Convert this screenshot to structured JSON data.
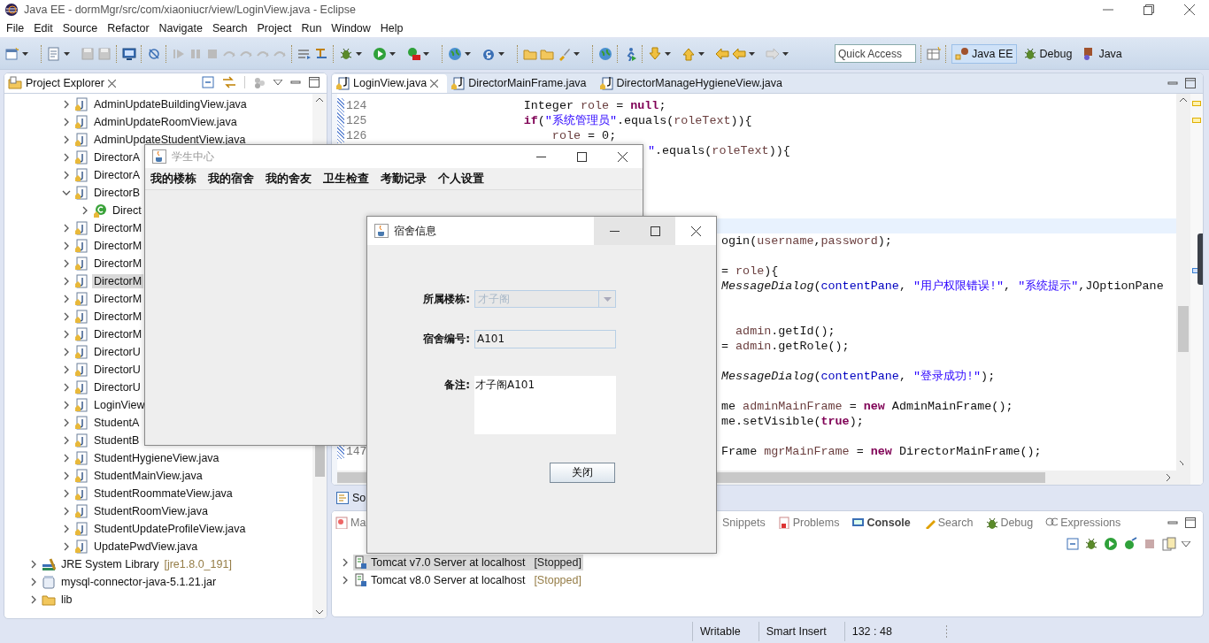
{
  "window": {
    "title": "Java EE - dormMgr/src/com/xiaoniucr/view/LoginView.java - Eclipse"
  },
  "menu": [
    "File",
    "Edit",
    "Source",
    "Refactor",
    "Navigate",
    "Search",
    "Project",
    "Run",
    "Window",
    "Help"
  ],
  "quick_access": {
    "placeholder": "Quick Access"
  },
  "perspectives": [
    {
      "label": "Java EE",
      "selected": true
    },
    {
      "label": "Debug",
      "selected": false
    },
    {
      "label": "Java",
      "selected": false
    }
  ],
  "project_explorer": {
    "title": "Project Explorer",
    "package_items": [
      {
        "label": "AdminUpdateBuildingView.java",
        "expanded": false,
        "selected": false
      },
      {
        "label": "AdminUpdateRoomView.java",
        "expanded": false,
        "selected": false
      },
      {
        "label": "AdminUpdateStudentView.java",
        "expanded": false,
        "selected": false
      },
      {
        "label": "DirectorA",
        "expanded": false,
        "selected": false
      },
      {
        "label": "DirectorA",
        "expanded": false,
        "selected": false
      },
      {
        "label": "DirectorB",
        "expanded": true,
        "selected": false,
        "children": [
          {
            "label": "Direct",
            "expanded": false,
            "selected": false
          }
        ]
      },
      {
        "label": "DirectorM",
        "expanded": false,
        "selected": false
      },
      {
        "label": "DirectorM",
        "expanded": false,
        "selected": false
      },
      {
        "label": "DirectorM",
        "expanded": false,
        "selected": false
      },
      {
        "label": "DirectorM",
        "expanded": false,
        "selected": true
      },
      {
        "label": "DirectorM",
        "expanded": false,
        "selected": false
      },
      {
        "label": "DirectorM",
        "expanded": false,
        "selected": false
      },
      {
        "label": "DirectorM",
        "expanded": false,
        "selected": false
      },
      {
        "label": "DirectorU",
        "expanded": false,
        "selected": false
      },
      {
        "label": "DirectorU",
        "expanded": false,
        "selected": false
      },
      {
        "label": "DirectorU",
        "expanded": false,
        "selected": false
      },
      {
        "label": "LoginView",
        "expanded": false,
        "selected": false
      },
      {
        "label": "StudentA",
        "expanded": false,
        "selected": false
      },
      {
        "label": "StudentB",
        "expanded": false,
        "selected": false
      },
      {
        "label": "StudentHygieneView.java",
        "expanded": false,
        "selected": false
      },
      {
        "label": "StudentMainView.java",
        "expanded": false,
        "selected": false
      },
      {
        "label": "StudentRoommateView.java",
        "expanded": false,
        "selected": false
      },
      {
        "label": "StudentRoomView.java",
        "expanded": false,
        "selected": false
      },
      {
        "label": "StudentUpdateProfileView.java",
        "expanded": false,
        "selected": false
      },
      {
        "label": "UpdatePwdView.java",
        "expanded": false,
        "selected": false
      }
    ],
    "project_items": [
      {
        "label": "JRE System Library",
        "detail": "[jre1.8.0_191]",
        "expanded": false,
        "selected": false
      },
      {
        "label": "mysql-connector-java-5.1.21.jar",
        "expanded": false,
        "selected": false
      },
      {
        "label": "lib",
        "expanded": false,
        "selected": false
      }
    ]
  },
  "editor": {
    "tabs": [
      {
        "label": "LoginView.java",
        "selected": true
      },
      {
        "label": "DirectorMainFrame.java",
        "selected": false
      },
      {
        "label": "DirectorManageHygieneView.java",
        "selected": false
      }
    ],
    "lines": [
      {
        "kind": "full",
        "number": "124",
        "current": false,
        "segments": [
          {
            "kind": "plain",
            "text": "                    Integer "
          },
          {
            "kind": "var",
            "text": "role"
          },
          {
            "kind": "plain",
            "text": " = "
          },
          {
            "kind": "kw",
            "text": "null"
          },
          {
            "kind": "plain",
            "text": ";"
          }
        ]
      },
      {
        "kind": "full",
        "number": "125",
        "current": false,
        "segments": [
          {
            "kind": "kw",
            "text": "                    if"
          },
          {
            "kind": "plain",
            "text": "("
          },
          {
            "kind": "str",
            "text": "\"系统管理员\""
          },
          {
            "kind": "plain",
            "text": ".equals("
          },
          {
            "kind": "var",
            "text": "roleText"
          },
          {
            "kind": "plain",
            "text": ")){"
          }
        ]
      },
      {
        "kind": "full",
        "number": "126",
        "current": false,
        "segments": [
          {
            "kind": "var",
            "text": "                        role"
          },
          {
            "kind": "plain",
            "text": " = 0;"
          }
        ]
      },
      {
        "kind": "tail-near",
        "current": false,
        "segments": [
          {
            "kind": "str",
            "text": "\""
          },
          {
            "kind": "plain",
            "text": ".equals("
          },
          {
            "kind": "var",
            "text": "roleText"
          },
          {
            "kind": "plain",
            "text": ")){"
          }
        ]
      },
      {
        "kind": "blank",
        "current": false
      },
      {
        "kind": "blank",
        "current": false
      },
      {
        "kind": "blank",
        "current": false
      },
      {
        "kind": "blank",
        "current": false
      },
      {
        "kind": "blank",
        "current": true
      },
      {
        "kind": "tail",
        "current": false,
        "segments": [
          {
            "kind": "plain",
            "text": "ogin("
          },
          {
            "kind": "var",
            "text": "username"
          },
          {
            "kind": "plain",
            "text": ","
          },
          {
            "kind": "var",
            "text": "password"
          },
          {
            "kind": "plain",
            "text": ");"
          }
        ]
      },
      {
        "kind": "blank",
        "current": false
      },
      {
        "kind": "tail",
        "current": false,
        "segments": [
          {
            "kind": "plain",
            "text": "= "
          },
          {
            "kind": "var",
            "text": "role"
          },
          {
            "kind": "plain",
            "text": "){"
          }
        ]
      },
      {
        "kind": "tail",
        "current": false,
        "segments": [
          {
            "kind": "static",
            "text": "MessageDialog"
          },
          {
            "kind": "plain",
            "text": "("
          },
          {
            "kind": "field",
            "text": "contentPane"
          },
          {
            "kind": "plain",
            "text": ", "
          },
          {
            "kind": "str",
            "text": "\"用户权限错误!\""
          },
          {
            "kind": "plain",
            "text": ", "
          },
          {
            "kind": "str",
            "text": "\"系统提示\""
          },
          {
            "kind": "plain",
            "text": ",JOptionPane"
          }
        ]
      },
      {
        "kind": "blank",
        "current": false
      },
      {
        "kind": "blank",
        "current": false
      },
      {
        "kind": "tail",
        "current": false,
        "segments": [
          {
            "kind": "var",
            "text": "  admin"
          },
          {
            "kind": "plain",
            "text": ".getId();"
          }
        ]
      },
      {
        "kind": "tail",
        "current": false,
        "segments": [
          {
            "kind": "plain",
            "text": "= "
          },
          {
            "kind": "var",
            "text": "admin"
          },
          {
            "kind": "plain",
            "text": ".getRole();"
          }
        ]
      },
      {
        "kind": "blank",
        "current": false
      },
      {
        "kind": "tail",
        "current": false,
        "segments": [
          {
            "kind": "static",
            "text": "MessageDialog"
          },
          {
            "kind": "plain",
            "text": "("
          },
          {
            "kind": "field",
            "text": "contentPane"
          },
          {
            "kind": "plain",
            "text": ", "
          },
          {
            "kind": "str",
            "text": "\"登录成功!\""
          },
          {
            "kind": "plain",
            "text": ");"
          }
        ]
      },
      {
        "kind": "blank",
        "current": false
      },
      {
        "kind": "tail",
        "current": false,
        "segments": [
          {
            "kind": "plain",
            "text": "me "
          },
          {
            "kind": "var",
            "text": "adminMainFrame"
          },
          {
            "kind": "plain",
            "text": " = "
          },
          {
            "kind": "kw",
            "text": "new"
          },
          {
            "kind": "plain",
            "text": " AdminMainFrame();"
          }
        ]
      },
      {
        "kind": "tail",
        "current": false,
        "segments": [
          {
            "kind": "plain",
            "text": "me.setVisible("
          },
          {
            "kind": "kw",
            "text": "true"
          },
          {
            "kind": "plain",
            "text": ");"
          }
        ]
      },
      {
        "kind": "blank",
        "current": false
      },
      {
        "kind": "numbered-tail",
        "number": "147",
        "current": false,
        "segments": [
          {
            "kind": "plain",
            "text": "Frame "
          },
          {
            "kind": "var",
            "text": "mgrMainFrame"
          },
          {
            "kind": "plain",
            "text": " = "
          },
          {
            "kind": "kw",
            "text": "new"
          },
          {
            "kind": "plain",
            "text": " DirectorMainFrame();"
          }
        ]
      }
    ]
  },
  "minimized_view": {
    "label": "So"
  },
  "bottom_panel": {
    "tabs": [
      {
        "label": "Ma",
        "kind": "covered",
        "updated": false
      },
      {
        "label": "Snippets",
        "kind": "open",
        "updated": false
      },
      {
        "label": "Problems",
        "kind": "open",
        "updated": false
      },
      {
        "label": "Console",
        "kind": "open",
        "updated": true
      },
      {
        "label": "Search",
        "kind": "open",
        "updated": false
      },
      {
        "label": "Debug",
        "kind": "open",
        "updated": false
      },
      {
        "label": "Expressions",
        "kind": "open",
        "updated": false
      }
    ],
    "servers": [
      {
        "name": "Tomcat v7.0 Server at localhost",
        "state": "[Stopped]",
        "selected": true
      },
      {
        "name": "Tomcat v8.0 Server at localhost",
        "state": "[Stopped]",
        "selected": false
      }
    ]
  },
  "status_bar": [
    "Writable",
    "Smart Insert",
    "132 : 48"
  ],
  "student_window": {
    "title": "学生中心",
    "active": false,
    "menu": [
      "我的楼栋",
      "我的宿舍",
      "我的舍友",
      "卫生检查",
      "考勤记录",
      "个人设置"
    ]
  },
  "dialog": {
    "title": "宿舍信息",
    "active": true,
    "fields": [
      {
        "kind": "combo",
        "label": "所属楼栋:",
        "value": "才子阁",
        "disabled": true
      },
      {
        "kind": "text",
        "label": "宿舍编号:",
        "value": "A101"
      },
      {
        "kind": "textarea",
        "label": "备注:",
        "value": "才子阁A101"
      }
    ],
    "buttons": [
      "关闭"
    ]
  }
}
